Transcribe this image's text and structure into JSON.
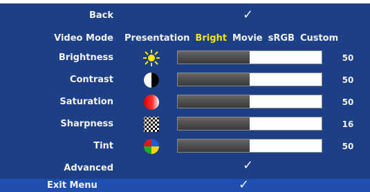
{
  "menu": {
    "back_label": "Back",
    "video_mode_label": "Video Mode",
    "brightness_label": "Brightness",
    "contrast_label": "Contrast",
    "saturation_label": "Saturation",
    "sharpness_label": "Sharpness",
    "tint_label": "Tint",
    "advanced_label": "Advanced",
    "exit_label": "Exit Menu",
    "check_glyph": "✓"
  },
  "video_modes": {
    "options": [
      "Presentation",
      "Bright",
      "Movie",
      "sRGB",
      "Custom"
    ],
    "selected": "Bright"
  },
  "settings": {
    "brightness": {
      "value": "50",
      "level_percent": 50
    },
    "contrast": {
      "value": "50",
      "level_percent": 50
    },
    "saturation": {
      "value": "50",
      "level_percent": 50
    },
    "sharpness": {
      "value": "16",
      "level_percent": 50
    },
    "tint": {
      "value": "50",
      "level_percent": 50
    }
  },
  "icons": {
    "brightness": "sun-icon",
    "contrast": "contrast-circle-icon",
    "saturation": "saturation-sphere-icon",
    "sharpness": "checkerboard-icon",
    "tint": "color-wheel-icon"
  },
  "colors": {
    "background": "#1d3f86",
    "exit_bar": "#1e4fb0",
    "selected_mode": "#f7e41c",
    "text": "#f2f2f2"
  }
}
